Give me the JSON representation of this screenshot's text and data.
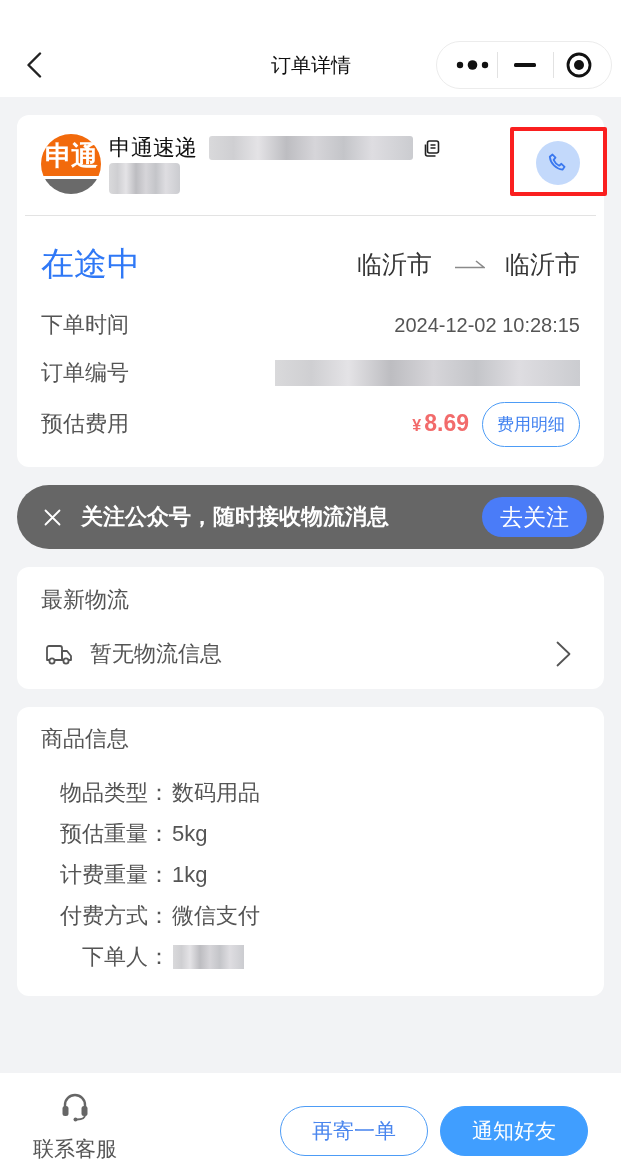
{
  "header": {
    "title": "订单详情"
  },
  "courier": {
    "logo_text": "申通",
    "name": "申通速递",
    "call_highlighted": true
  },
  "order": {
    "status": "在途中",
    "from_city": "临沂市",
    "to_city": "临沂市",
    "rows": [
      {
        "kind": "text",
        "label": "下单时间",
        "value": "2024-12-02 10:28:15"
      },
      {
        "kind": "redacted",
        "label": "订单编号"
      },
      {
        "kind": "price",
        "label": "预估费用",
        "currency": "¥",
        "amount": "8.69",
        "button": "费用明细"
      }
    ]
  },
  "banner": {
    "text": "关注公众号，随时接收物流消息",
    "button": "去关注"
  },
  "logistics": {
    "title": "最新物流",
    "status": "暂无物流信息"
  },
  "goods": {
    "title": "商品信息",
    "rows": [
      {
        "kind": "text",
        "label": "物品类型：",
        "value": "数码用品"
      },
      {
        "kind": "text",
        "label": "预估重量：",
        "value": "5kg"
      },
      {
        "kind": "text",
        "label": "计费重量：",
        "value": "1kg"
      },
      {
        "kind": "text",
        "label": "付费方式：",
        "value": "微信支付"
      },
      {
        "kind": "redacted",
        "label": "下单人："
      }
    ]
  },
  "footer": {
    "service": "联系客服",
    "buttons": [
      {
        "kind": "outline",
        "label": "再寄一单"
      },
      {
        "kind": "primary",
        "label": "通知好友"
      }
    ]
  }
}
